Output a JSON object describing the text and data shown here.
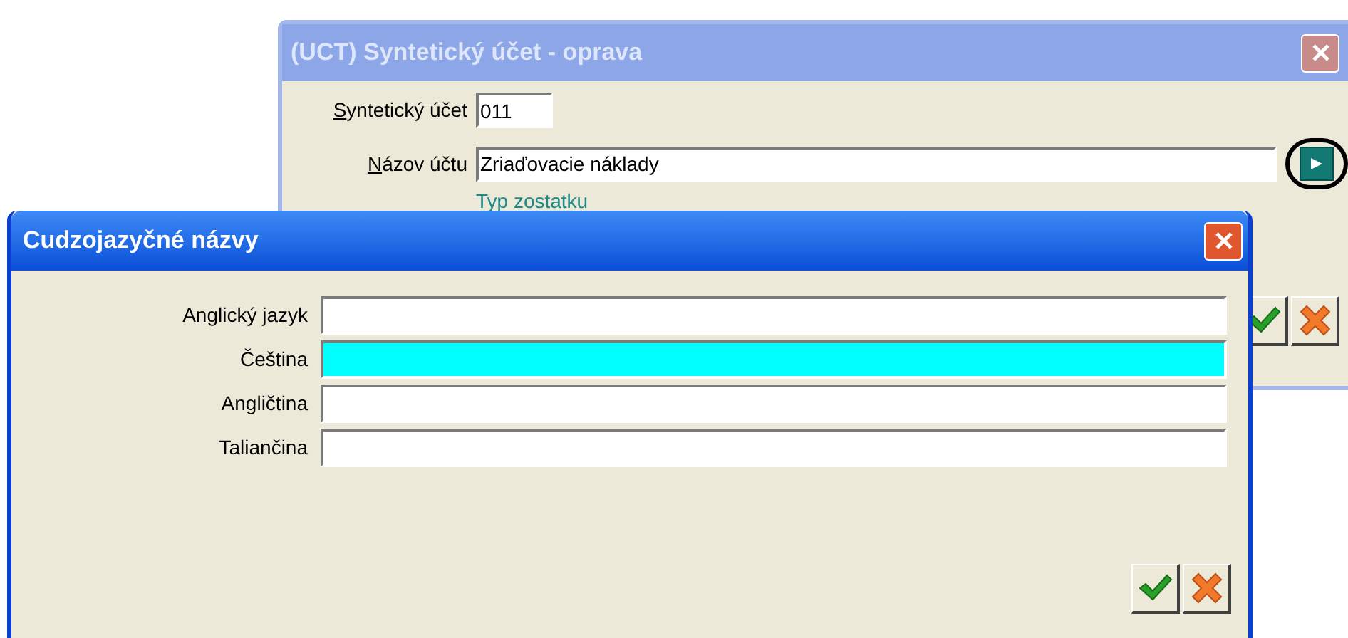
{
  "back_window": {
    "title": "(UCT) Syntetický účet - oprava",
    "active": false,
    "fields": [
      {
        "label": "Syntetický účet",
        "value": "011",
        "underline_first": true,
        "kind": "short"
      },
      {
        "label": "Názov účtu",
        "value": "Zriaďovacie náklady",
        "underline_first": true,
        "kind": "long"
      }
    ],
    "group_title": "Typ zostatku"
  },
  "front_window": {
    "title": "Cudzojazyčné názvy",
    "active": true,
    "fields": [
      {
        "label": "Anglický jazyk",
        "highlighted": false
      },
      {
        "label": "Čeština",
        "highlighted": true
      },
      {
        "label": "Angličtina",
        "highlighted": false
      },
      {
        "label": "Taliančina",
        "highlighted": false
      }
    ]
  }
}
